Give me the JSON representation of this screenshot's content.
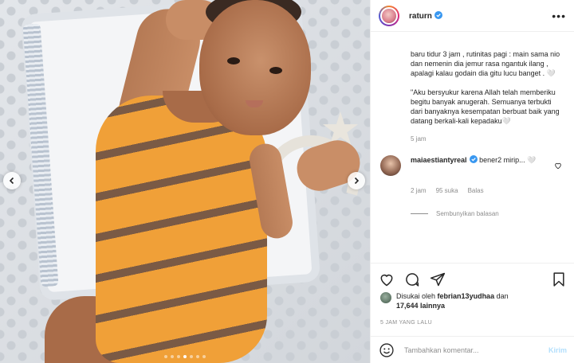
{
  "header": {
    "username": "raturn",
    "more_label": "•••"
  },
  "caption": {
    "paragraph1": "baru tidur 3 jam , rutinitas pagi : main sama nio dan nemenin dia jemur rasa ngantuk ilang , apalagi kalau godain dia gitu lucu banget . 🤍",
    "paragraph2": "\"Aku bersyukur karena Allah telah memberiku begitu banyak anugerah. Semuanya terbukti dari banyaknya kesempatan berbuat baik yang datang berkali-kali kepadaku🤍",
    "time": "5 jam"
  },
  "comment": {
    "username": "maiaestiantyreal",
    "text": "bener2 mirip... 🤍",
    "time": "2 jam",
    "likes": "95 suka",
    "reply_label": "Balas",
    "hide_replies_label": "Sembunyikan balasan"
  },
  "likes": {
    "prefix": "Disukai oleh",
    "liker": "febrian13yudhaa",
    "conjunction": "dan",
    "others": "17,644 lainnya"
  },
  "timestamp": "5 JAM YANG LALU",
  "compose": {
    "placeholder": "Tambahkan komentar...",
    "post_label": "Kirim"
  },
  "carousel": {
    "dot_count": 7,
    "active_index": 3
  },
  "colors": {
    "verified": "#3897f0",
    "post_button": "#b2dffc",
    "secondary_text": "#8e8e8e"
  },
  "icons": [
    "more-icon",
    "verified-icon",
    "heart-icon",
    "comment-icon",
    "share-icon",
    "bookmark-icon",
    "emoji-icon",
    "chevron-left-icon",
    "chevron-right-icon"
  ]
}
